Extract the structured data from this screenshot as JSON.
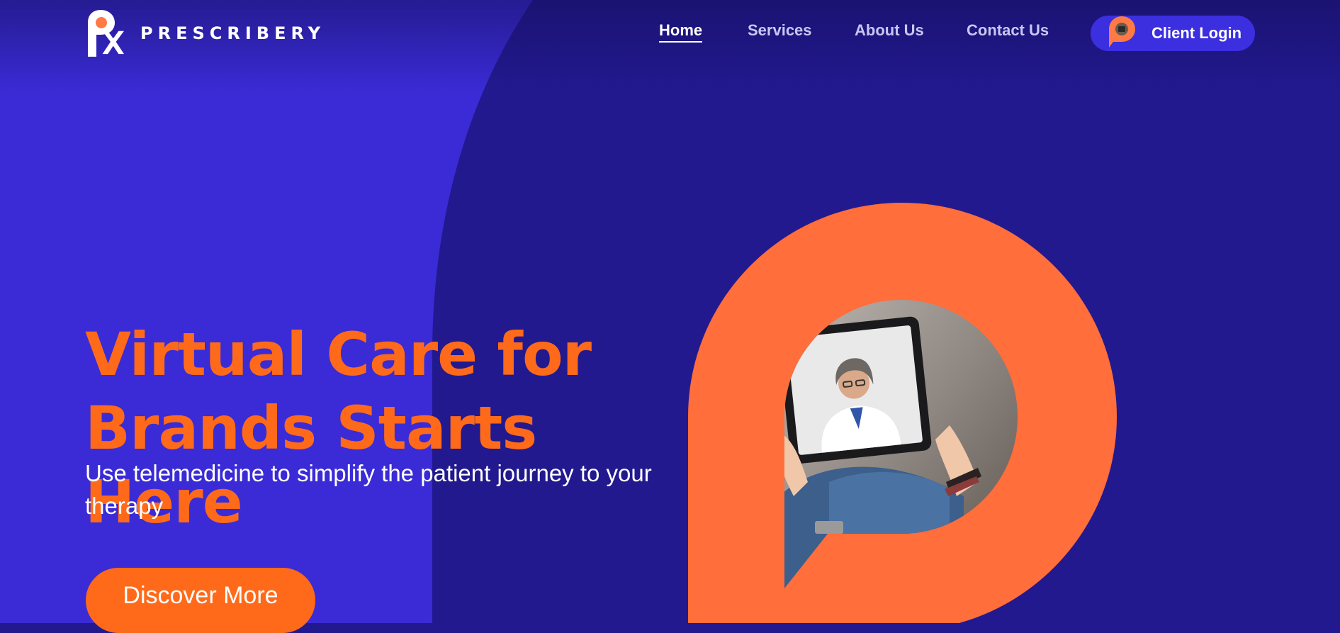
{
  "brand": {
    "name": "PRESCRIBERY"
  },
  "nav": {
    "items": [
      {
        "label": "Home",
        "active": true
      },
      {
        "label": "Services",
        "active": false
      },
      {
        "label": "About Us",
        "active": false
      },
      {
        "label": "Contact Us",
        "active": false
      }
    ],
    "login_label": "Client Login"
  },
  "hero": {
    "title_line1": "Virtual Care for",
    "title_line2": "Brands Starts Here",
    "subtitle": "Use telemedicine to simplify the patient journey to your therapy",
    "cta_label": "Discover More",
    "image_icon": "doctor-on-tablet-photo"
  },
  "colors": {
    "background_dark": "#22198f",
    "background_light": "#3a2bd6",
    "accent_orange": "#ff6a1a",
    "logo_orange": "#ff7a45",
    "text_white": "#ffffff"
  }
}
